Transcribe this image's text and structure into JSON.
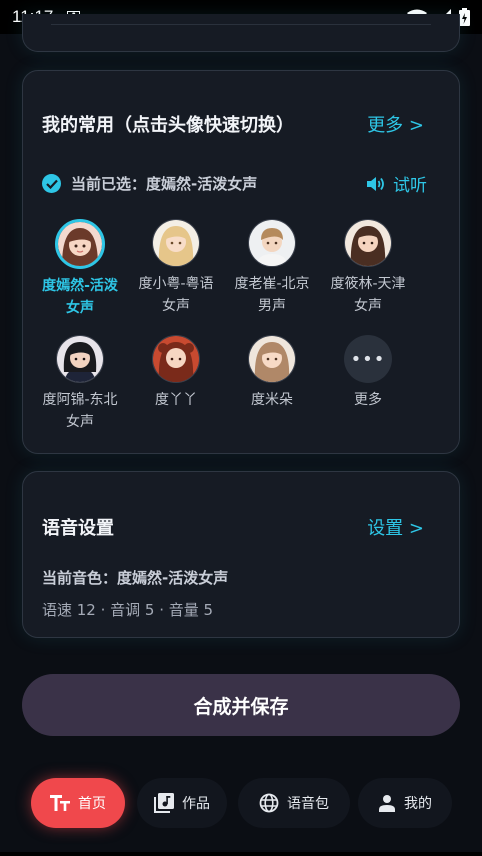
{
  "status_bar": {
    "time": "11:17",
    "app_icon_letter": "A"
  },
  "favorites": {
    "title": "我的常用（点击头像快速切换）",
    "more_label": "更多 >",
    "selected_text": "当前已选：度嫣然-活泼女声",
    "listen_label": "试听",
    "voices": [
      {
        "label": "度嫣然-活泼女声",
        "selected": true,
        "avatar": "cartoon-girl-brown-hair"
      },
      {
        "label": "度小粤-粤语女声",
        "selected": false,
        "avatar": "cartoon-girl-blonde"
      },
      {
        "label": "度老崔-北京男声",
        "selected": false,
        "avatar": "cartoon-boy-light-hair"
      },
      {
        "label": "度筱林-天津女声",
        "selected": false,
        "avatar": "cartoon-girl-dark-hair"
      },
      {
        "label": "度阿锦-东北女声",
        "selected": false,
        "avatar": "cartoon-girl-black-hair"
      },
      {
        "label": "度丫丫",
        "selected": false,
        "avatar": "cartoon-girl-red-dress"
      },
      {
        "label": "度米朵",
        "selected": false,
        "avatar": "cartoon-girl-light-brown"
      },
      {
        "label": "更多",
        "selected": false,
        "avatar": "more-dots"
      }
    ]
  },
  "voice_settings": {
    "title": "语音设置",
    "settings_label": "设置 >",
    "current_voice": "当前音色：度嫣然-活泼女声",
    "params": "语速 12 · 音调 5 · 音量 5"
  },
  "save_button": {
    "label": "合成并保存"
  },
  "nav": [
    {
      "label": "首页",
      "active": true,
      "icon": "text-format-icon"
    },
    {
      "label": "作品",
      "active": false,
      "icon": "library-music-icon"
    },
    {
      "label": "语音包",
      "active": false,
      "icon": "globe-icon"
    },
    {
      "label": "我的",
      "active": false,
      "icon": "person-icon"
    }
  ],
  "colors": {
    "accent": "#2ec6e6",
    "active_nav": "#f0484c",
    "save_button": "#3a3248"
  }
}
